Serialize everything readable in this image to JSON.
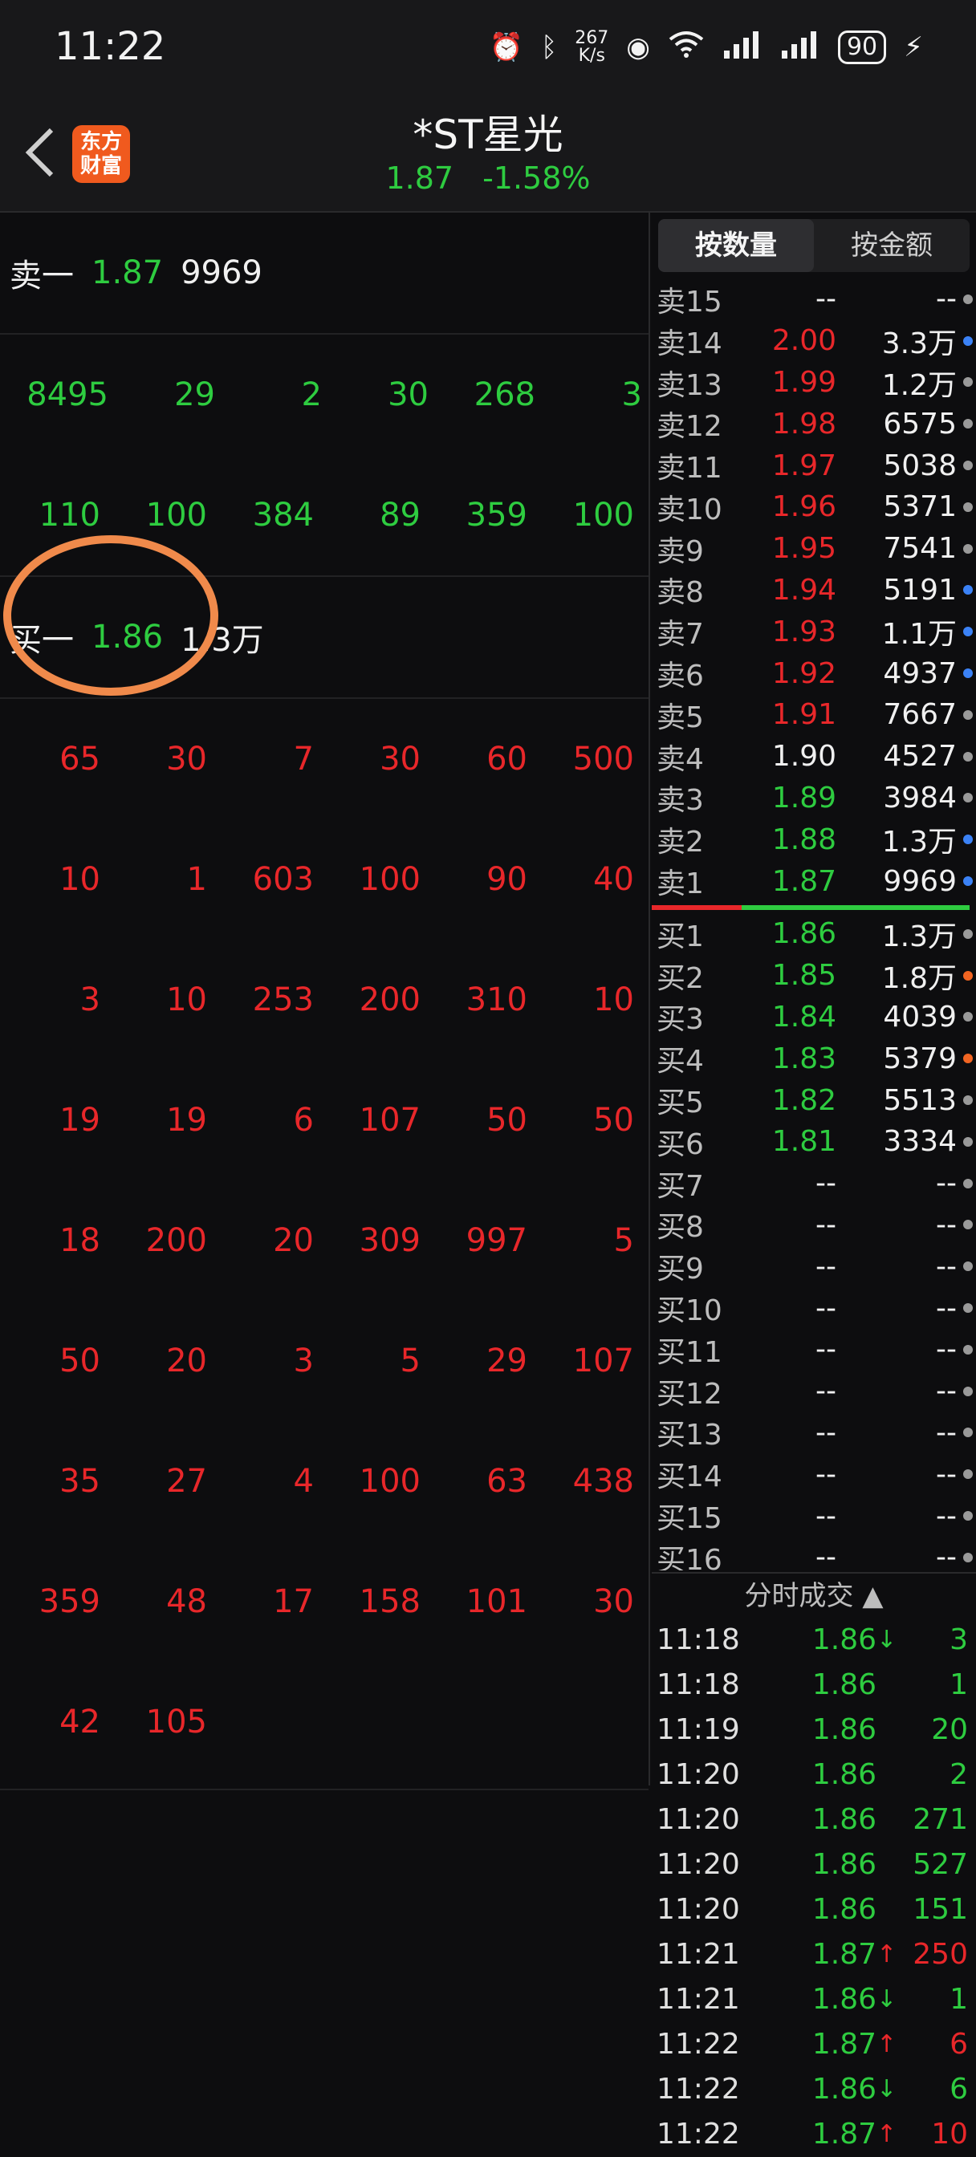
{
  "status": {
    "time": "11:22",
    "net_speed_value": "267",
    "net_speed_unit": "K/s",
    "battery": "90"
  },
  "header": {
    "logo_line1": "东方",
    "logo_line2": "财富",
    "title": "*ST星光",
    "price": "1.87",
    "change": "-1.58%"
  },
  "left": {
    "sell1": {
      "label": "卖一",
      "price": "1.87",
      "volume": "9969"
    },
    "sell_orders": [
      [
        "8495",
        "29",
        "2",
        "30",
        "268",
        "3"
      ],
      [
        "110",
        "100",
        "384",
        "89",
        "359",
        "100"
      ]
    ],
    "buy1": {
      "label": "买一",
      "price": "1.86",
      "volume": "1.3万"
    },
    "buy_orders": [
      [
        "65",
        "30",
        "7",
        "30",
        "60",
        "500"
      ],
      [
        "10",
        "1",
        "603",
        "100",
        "90",
        "40"
      ],
      [
        "3",
        "10",
        "253",
        "200",
        "310",
        "10"
      ],
      [
        "19",
        "19",
        "6",
        "107",
        "50",
        "50"
      ],
      [
        "18",
        "200",
        "20",
        "309",
        "997",
        "5"
      ],
      [
        "50",
        "20",
        "3",
        "5",
        "29",
        "107"
      ],
      [
        "35",
        "27",
        "4",
        "100",
        "63",
        "438"
      ],
      [
        "359",
        "48",
        "17",
        "158",
        "101",
        "30"
      ],
      [
        "42",
        "105",
        "",
        "",
        "",
        ""
      ]
    ]
  },
  "tabs": {
    "by_quantity": "按数量",
    "by_amount": "按金额"
  },
  "sell_book": [
    {
      "label": "卖15",
      "price": "--",
      "volume": "--",
      "price_color": "white",
      "dot": "gray"
    },
    {
      "label": "卖14",
      "price": "2.00",
      "volume": "3.3万",
      "price_color": "red",
      "dot": "blue"
    },
    {
      "label": "卖13",
      "price": "1.99",
      "volume": "1.2万",
      "price_color": "red",
      "dot": "gray"
    },
    {
      "label": "卖12",
      "price": "1.98",
      "volume": "6575",
      "price_color": "red",
      "dot": "gray"
    },
    {
      "label": "卖11",
      "price": "1.97",
      "volume": "5038",
      "price_color": "red",
      "dot": "gray"
    },
    {
      "label": "卖10",
      "price": "1.96",
      "volume": "5371",
      "price_color": "red",
      "dot": "gray"
    },
    {
      "label": "卖9",
      "price": "1.95",
      "volume": "7541",
      "price_color": "red",
      "dot": "gray"
    },
    {
      "label": "卖8",
      "price": "1.94",
      "volume": "5191",
      "price_color": "red",
      "dot": "blue"
    },
    {
      "label": "卖7",
      "price": "1.93",
      "volume": "1.1万",
      "price_color": "red",
      "dot": "blue"
    },
    {
      "label": "卖6",
      "price": "1.92",
      "volume": "4937",
      "price_color": "red",
      "dot": "blue"
    },
    {
      "label": "卖5",
      "price": "1.91",
      "volume": "7667",
      "price_color": "red",
      "dot": "gray"
    },
    {
      "label": "卖4",
      "price": "1.90",
      "volume": "4527",
      "price_color": "white",
      "dot": "gray"
    },
    {
      "label": "卖3",
      "price": "1.89",
      "volume": "3984",
      "price_color": "green",
      "dot": "gray"
    },
    {
      "label": "卖2",
      "price": "1.88",
      "volume": "1.3万",
      "price_color": "green",
      "dot": "blue"
    },
    {
      "label": "卖1",
      "price": "1.87",
      "volume": "9969",
      "price_color": "green",
      "dot": "blue"
    }
  ],
  "buy_book": [
    {
      "label": "买1",
      "price": "1.86",
      "volume": "1.3万",
      "price_color": "green",
      "dot": "gray"
    },
    {
      "label": "买2",
      "price": "1.85",
      "volume": "1.8万",
      "price_color": "green",
      "dot": "orange"
    },
    {
      "label": "买3",
      "price": "1.84",
      "volume": "4039",
      "price_color": "green",
      "dot": "gray"
    },
    {
      "label": "买4",
      "price": "1.83",
      "volume": "5379",
      "price_color": "green",
      "dot": "orange"
    },
    {
      "label": "买5",
      "price": "1.82",
      "volume": "5513",
      "price_color": "green",
      "dot": "gray"
    },
    {
      "label": "买6",
      "price": "1.81",
      "volume": "3334",
      "price_color": "green",
      "dot": "gray"
    },
    {
      "label": "买7",
      "price": "--",
      "volume": "--",
      "price_color": "white",
      "dot": "gray"
    },
    {
      "label": "买8",
      "price": "--",
      "volume": "--",
      "price_color": "white",
      "dot": "gray"
    },
    {
      "label": "买9",
      "price": "--",
      "volume": "--",
      "price_color": "white",
      "dot": "gray"
    },
    {
      "label": "买10",
      "price": "--",
      "volume": "--",
      "price_color": "white",
      "dot": "gray"
    },
    {
      "label": "买11",
      "price": "--",
      "volume": "--",
      "price_color": "white",
      "dot": "gray"
    },
    {
      "label": "买12",
      "price": "--",
      "volume": "--",
      "price_color": "white",
      "dot": "gray"
    },
    {
      "label": "买13",
      "price": "--",
      "volume": "--",
      "price_color": "white",
      "dot": "gray"
    },
    {
      "label": "买14",
      "price": "--",
      "volume": "--",
      "price_color": "white",
      "dot": "gray"
    },
    {
      "label": "买15",
      "price": "--",
      "volume": "--",
      "price_color": "white",
      "dot": "gray"
    },
    {
      "label": "买16",
      "price": "--",
      "volume": "--",
      "price_color": "white",
      "dot": "gray"
    }
  ],
  "trades_header": "分时成交",
  "trades": [
    {
      "time": "11:18",
      "price": "1.86",
      "arrow": "↓",
      "volume": "3",
      "color": "green"
    },
    {
      "time": "11:18",
      "price": "1.86",
      "arrow": "",
      "volume": "1",
      "color": "green"
    },
    {
      "time": "11:19",
      "price": "1.86",
      "arrow": "",
      "volume": "20",
      "color": "green"
    },
    {
      "time": "11:20",
      "price": "1.86",
      "arrow": "",
      "volume": "2",
      "color": "green"
    },
    {
      "time": "11:20",
      "price": "1.86",
      "arrow": "",
      "volume": "271",
      "color": "green"
    },
    {
      "time": "11:20",
      "price": "1.86",
      "arrow": "",
      "volume": "527",
      "color": "green"
    },
    {
      "time": "11:20",
      "price": "1.86",
      "arrow": "",
      "volume": "151",
      "color": "green"
    },
    {
      "time": "11:21",
      "price": "1.87",
      "arrow": "↑",
      "volume": "250",
      "color": "red"
    },
    {
      "time": "11:21",
      "price": "1.86",
      "arrow": "↓",
      "volume": "1",
      "color": "green"
    },
    {
      "time": "11:22",
      "price": "1.87",
      "arrow": "↑",
      "volume": "6",
      "color": "red"
    },
    {
      "time": "11:22",
      "price": "1.86",
      "arrow": "↓",
      "volume": "6",
      "color": "green"
    },
    {
      "time": "11:22",
      "price": "1.87",
      "arrow": "↑",
      "volume": "10",
      "color": "red"
    }
  ]
}
